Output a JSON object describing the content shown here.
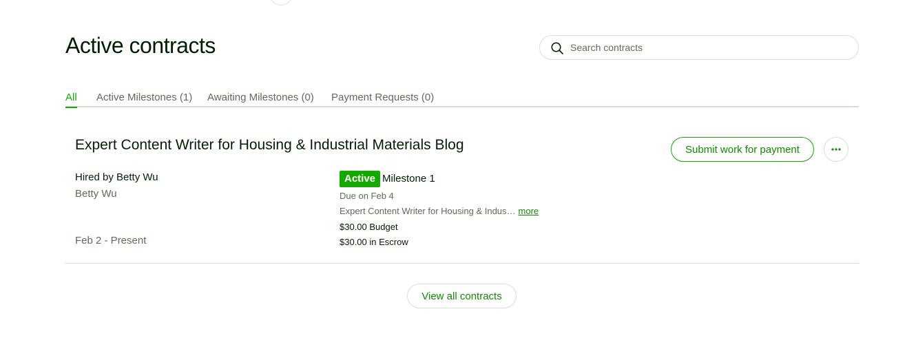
{
  "page": {
    "title": "Active contracts"
  },
  "search": {
    "placeholder": "Search contracts",
    "icon": "search-icon"
  },
  "tabs": [
    {
      "label": "All",
      "active": true
    },
    {
      "label": "Active Milestones (1)",
      "active": false
    },
    {
      "label": "Awaiting Milestones (0)",
      "active": false
    },
    {
      "label": "Payment Requests (0)",
      "active": false
    }
  ],
  "contract": {
    "title": "Expert Content Writer for Housing & Industrial Materials Blog",
    "submit_label": "Submit work for payment",
    "more_icon": "ellipsis-icon",
    "hired_by": "Hired by Betty Wu",
    "client_name": "Betty Wu",
    "date_range": "Feb 2 - Present",
    "status": "Active",
    "milestone": "Milestone 1",
    "due": "Due on Feb 4",
    "description": "Expert Content Writer for Housing & Indus…",
    "more_link": "more",
    "budget": "$30.00 Budget",
    "escrow": "$30.00 in Escrow"
  },
  "footer": {
    "view_all_label": "View all contracts"
  },
  "colors": {
    "accent": "#14a800",
    "accent_text": "#108a00",
    "text_primary": "#001e00",
    "text_secondary": "#5e6d55",
    "border": "#d5e0d5"
  }
}
